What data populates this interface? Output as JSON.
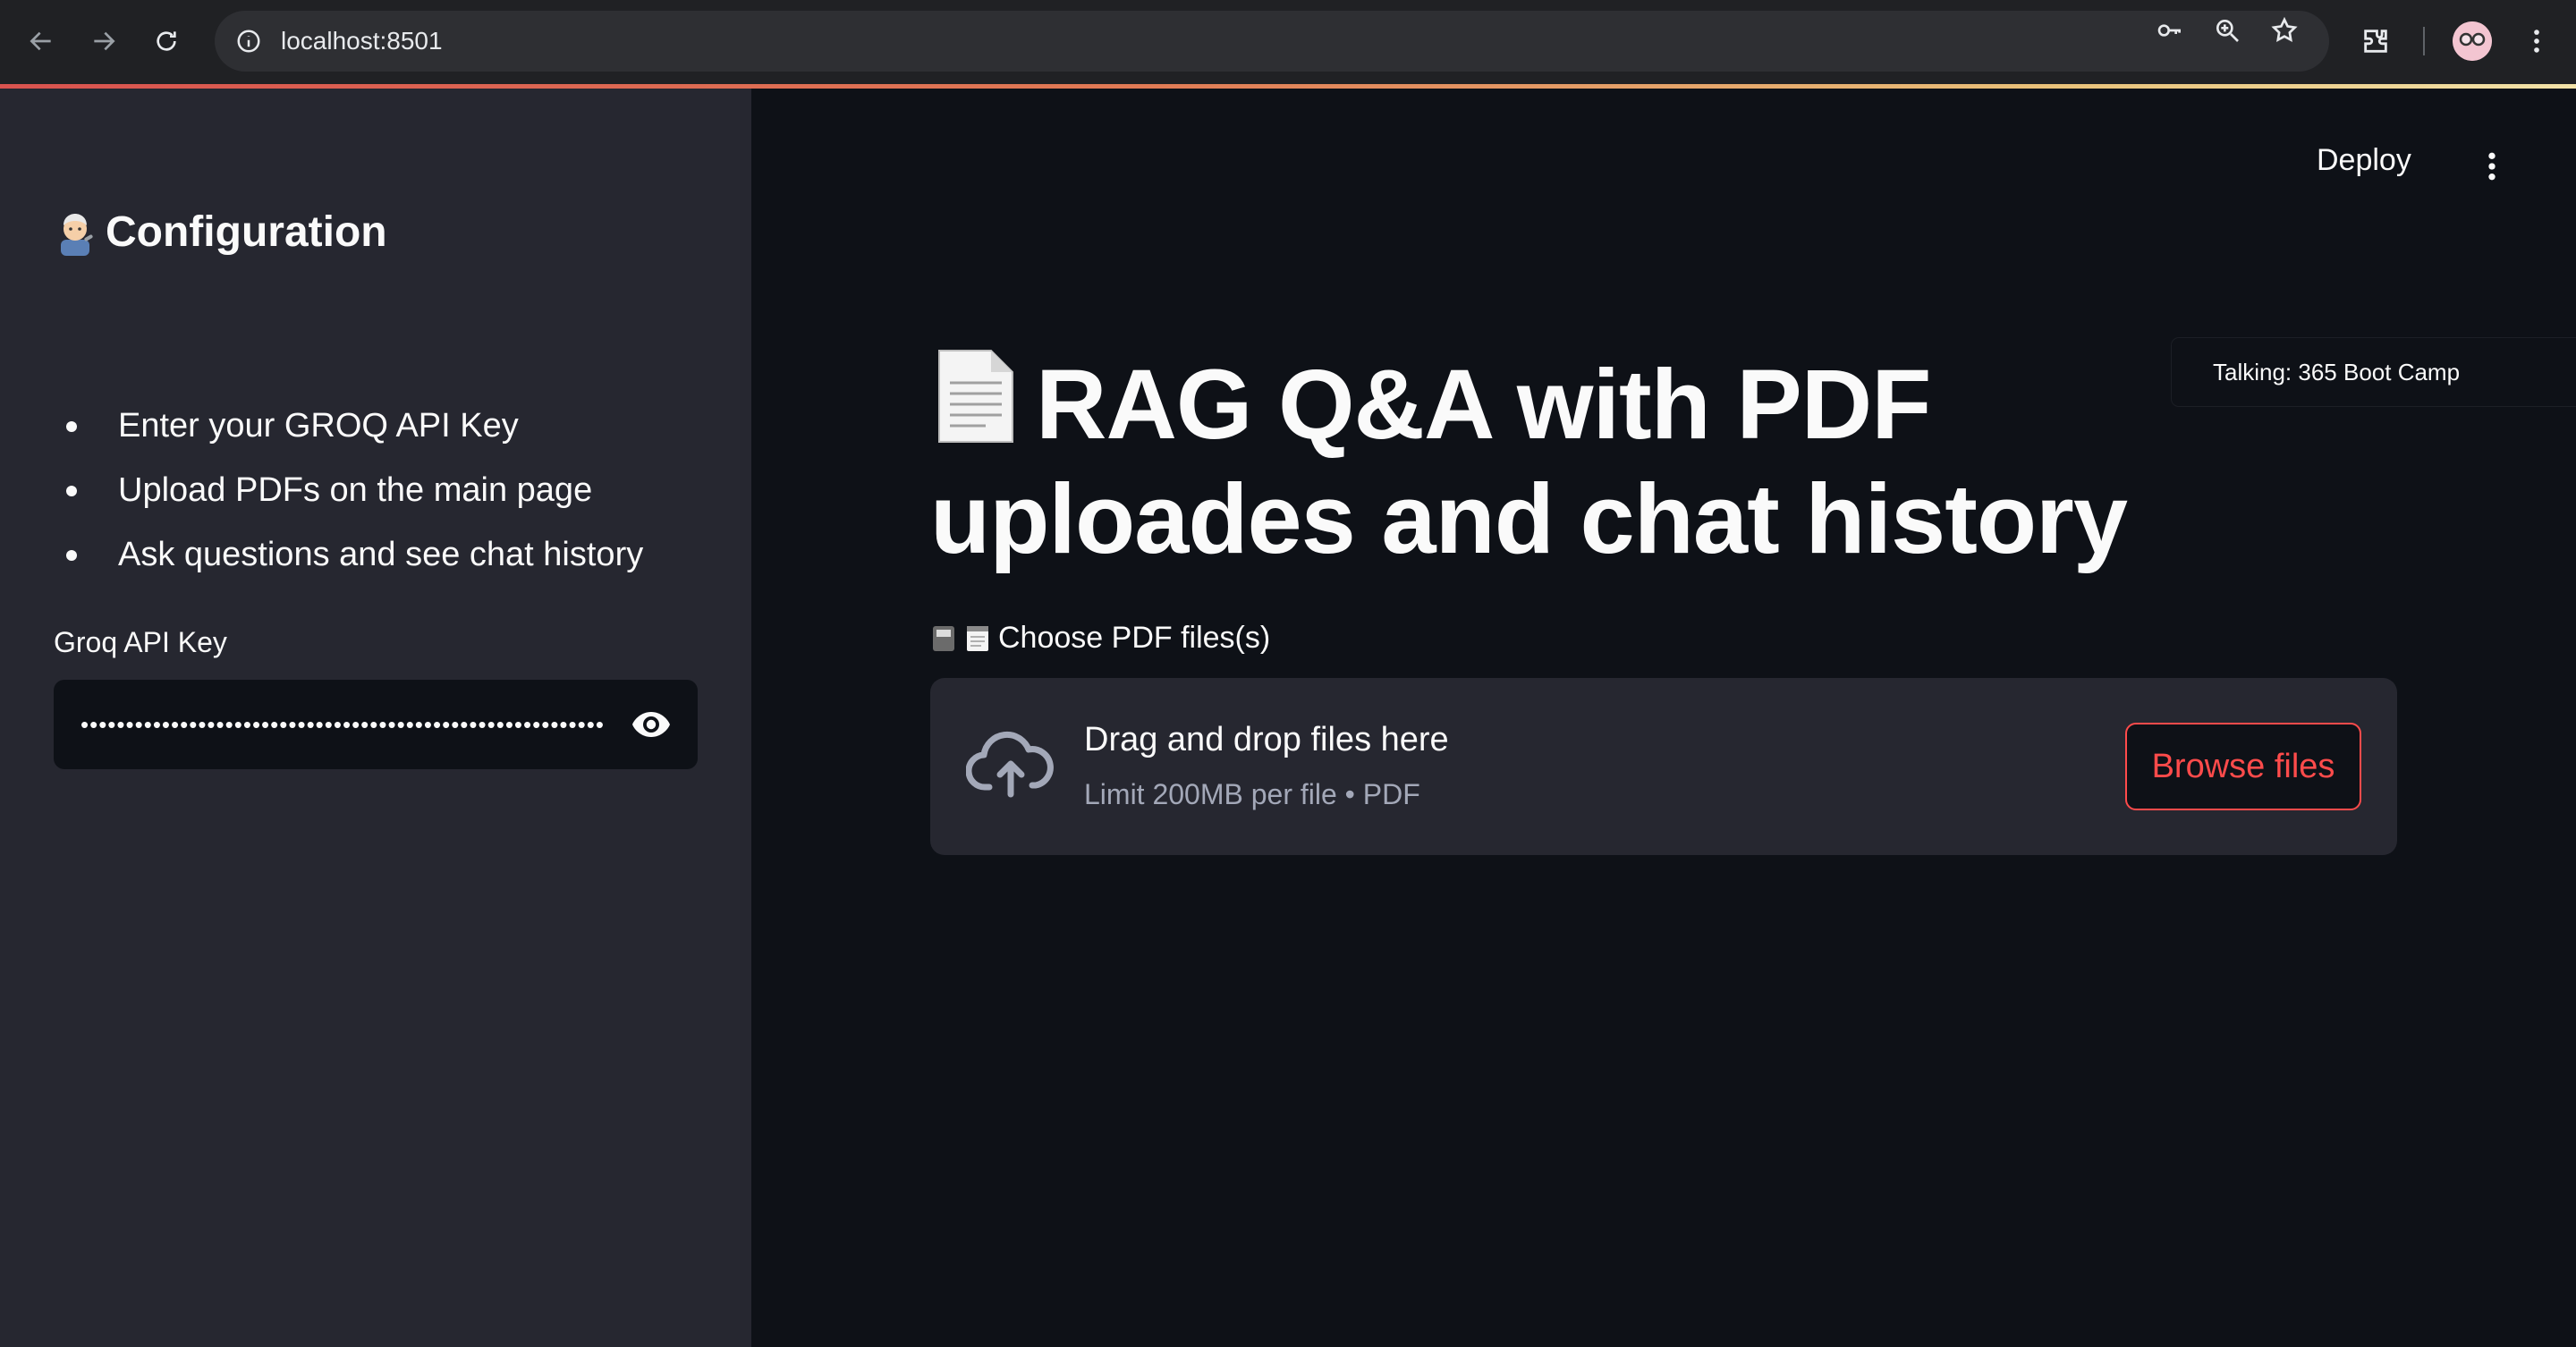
{
  "browser": {
    "url": "localhost:8501"
  },
  "sidebar": {
    "title": "Configuration",
    "bullets": [
      "Enter your GROQ API Key",
      "Upload PDFs on the main page",
      "Ask questions and see chat history"
    ],
    "api_key_label": "Groq API Key",
    "api_key_masked": "••••••••••••••••••••••••••••••••••••••••••••••••••••••••••"
  },
  "header": {
    "deploy_label": "Deploy"
  },
  "main": {
    "title": "RAG Q&A with PDF uploades and chat history",
    "uploader_label": "Choose PDF files(s)",
    "dropzone_title": "Drag and drop files here",
    "dropzone_subtitle": "Limit 200MB per file • PDF",
    "browse_label": "Browse files"
  },
  "toast": {
    "text": "Talking: 365 Boot Camp"
  },
  "colors": {
    "accent": "#ff4b4b",
    "sidebar_bg": "#262730",
    "main_bg": "#0e1117",
    "chrome_bg": "#202124"
  }
}
